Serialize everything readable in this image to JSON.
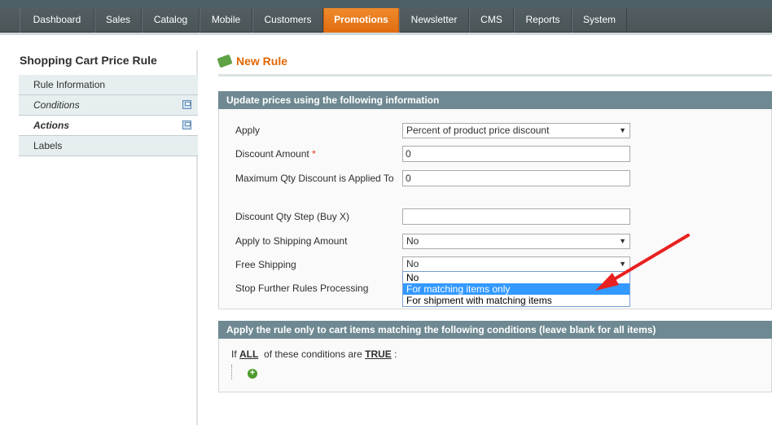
{
  "nav": {
    "items": [
      {
        "label": "Dashboard",
        "active": false
      },
      {
        "label": "Sales",
        "active": false
      },
      {
        "label": "Catalog",
        "active": false
      },
      {
        "label": "Mobile",
        "active": false
      },
      {
        "label": "Customers",
        "active": false
      },
      {
        "label": "Promotions",
        "active": true
      },
      {
        "label": "Newsletter",
        "active": false
      },
      {
        "label": "CMS",
        "active": false
      },
      {
        "label": "Reports",
        "active": false
      },
      {
        "label": "System",
        "active": false
      }
    ]
  },
  "sidebar": {
    "title": "Shopping Cart Price Rule",
    "tabs": [
      {
        "label": "Rule Information"
      },
      {
        "label": "Conditions"
      },
      {
        "label": "Actions"
      },
      {
        "label": "Labels"
      }
    ]
  },
  "page": {
    "title": "New Rule"
  },
  "actions_section": {
    "heading": "Update prices using the following information",
    "fields": {
      "apply": {
        "label": "Apply",
        "value": "Percent of product price discount"
      },
      "discount_amount": {
        "label": "Discount Amount",
        "required": "*",
        "value": "0"
      },
      "max_qty": {
        "label": "Maximum Qty Discount is Applied To",
        "value": "0"
      },
      "qty_step": {
        "label": "Discount Qty Step (Buy X)",
        "value": ""
      },
      "apply_shipping": {
        "label": "Apply to Shipping Amount",
        "value": "No"
      },
      "free_shipping": {
        "label": "Free Shipping",
        "value": "No",
        "options": [
          "No",
          "For matching items only",
          "For shipment with matching items"
        ],
        "highlighted": "For matching items only"
      },
      "stop_rules": {
        "label": "Stop Further Rules Processing"
      }
    }
  },
  "conditions_section": {
    "heading": "Apply the rule only to cart items matching the following conditions (leave blank for all items)",
    "prefix": "If",
    "aggregator": "ALL",
    "middle": "of these conditions are",
    "value": "TRUE",
    "suffix": ":"
  },
  "colors": {
    "accent": "#e26703",
    "nav_active": "#eb7b1e",
    "section_header": "#6f8992",
    "annotation_arrow": "#e8201f"
  }
}
